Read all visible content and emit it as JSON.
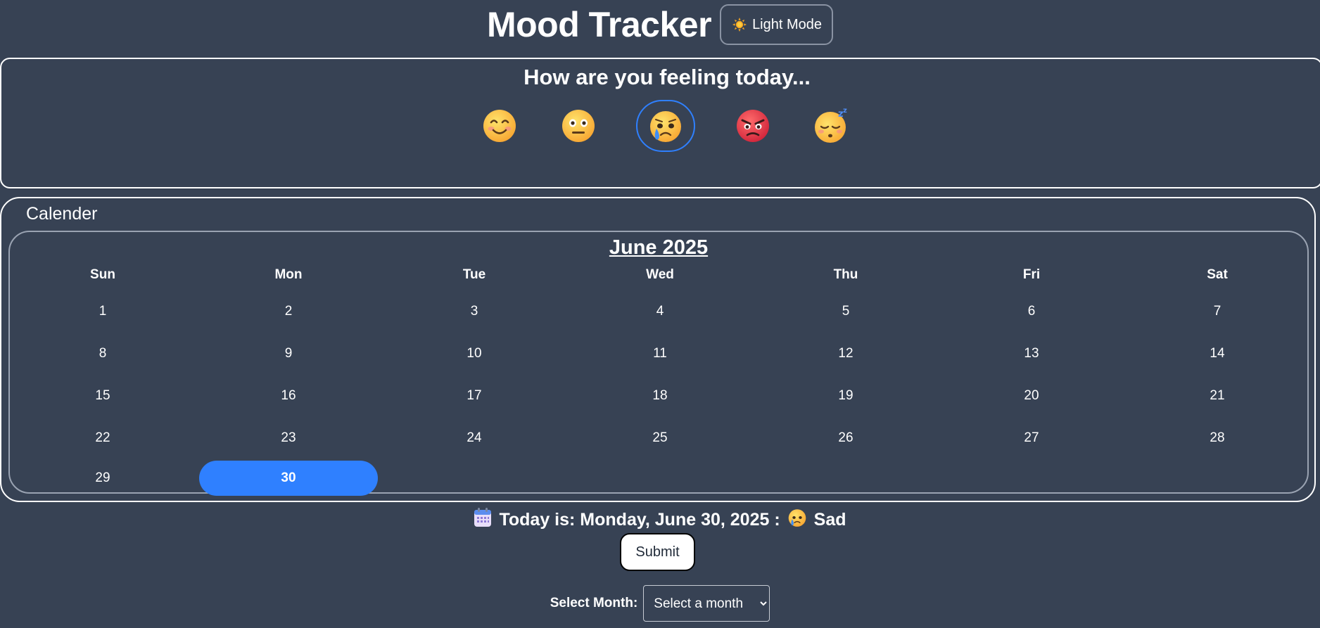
{
  "header": {
    "title": "Mood Tracker",
    "theme_toggle_label": "Light Mode",
    "theme_toggle_icon": "sun-icon"
  },
  "mood": {
    "question": "How are you feeling today...",
    "options": [
      {
        "name": "happy",
        "icon": "smiling-face-icon",
        "selected": false
      },
      {
        "name": "neutral",
        "icon": "neutral-face-icon",
        "selected": false
      },
      {
        "name": "sad",
        "icon": "crying-face-icon",
        "selected": true
      },
      {
        "name": "angry",
        "icon": "angry-face-icon",
        "selected": false
      },
      {
        "name": "sleepy",
        "icon": "sleeping-face-icon",
        "selected": false
      }
    ]
  },
  "calendar": {
    "label": "Calender",
    "month_title": "June 2025",
    "weekdays": [
      "Sun",
      "Mon",
      "Tue",
      "Wed",
      "Thu",
      "Fri",
      "Sat"
    ],
    "weeks": [
      [
        "1",
        "2",
        "3",
        "4",
        "5",
        "6",
        "7"
      ],
      [
        "8",
        "9",
        "10",
        "11",
        "12",
        "13",
        "14"
      ],
      [
        "15",
        "16",
        "17",
        "18",
        "19",
        "20",
        "21"
      ],
      [
        "22",
        "23",
        "24",
        "25",
        "26",
        "27",
        "28"
      ],
      [
        "29",
        "30",
        "",
        "",
        "",
        "",
        ""
      ]
    ],
    "today": "30",
    "accent_color": "#2f80ff"
  },
  "status": {
    "calendar_icon": "calendar-icon",
    "today_text": "Today is: Monday, June 30, 2025 :",
    "mood_icon": "crying-face-icon",
    "mood_label": "Sad"
  },
  "submit_label": "Submit",
  "month_select": {
    "label": "Select Month:",
    "selected": "Select a month"
  },
  "colors": {
    "background": "#374254",
    "text": "#ffffff"
  }
}
